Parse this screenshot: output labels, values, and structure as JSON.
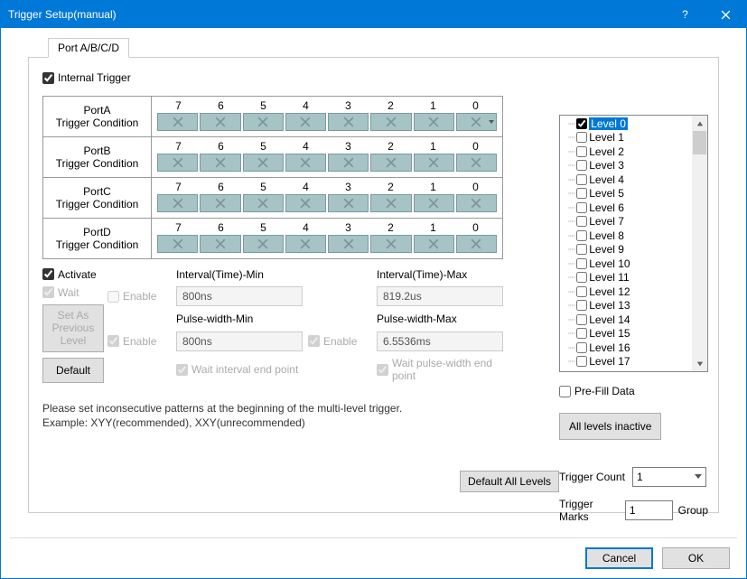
{
  "window": {
    "title": "Trigger Setup(manual)"
  },
  "tab": {
    "label": "Port A/B/C/D"
  },
  "internal_trigger": {
    "label": "Internal Trigger",
    "checked": true
  },
  "bits": [
    "7",
    "6",
    "5",
    "4",
    "3",
    "2",
    "1",
    "0"
  ],
  "ports": [
    {
      "name": "PortA",
      "cond": "Trigger Condition"
    },
    {
      "name": "PortB",
      "cond": "Trigger Condition"
    },
    {
      "name": "PortC",
      "cond": "Trigger Condition"
    },
    {
      "name": "PortD",
      "cond": "Trigger Condition"
    }
  ],
  "activate": {
    "label": "Activate",
    "checked": true
  },
  "wait": {
    "label": "Wait",
    "checked": true
  },
  "set_prev": "Set As Previous Level",
  "default_btn": "Default",
  "intv_min": {
    "head": "Interval(Time)-Min",
    "enable": "Enable",
    "value": "800ns"
  },
  "intv_max": {
    "head": "Interval(Time)-Max",
    "value": "819.2us"
  },
  "pw_min": {
    "head": "Pulse-width-Min",
    "enable": "Enable",
    "value": "800ns"
  },
  "pw_max": {
    "head": "Pulse-width-Max",
    "enable": "Enable",
    "value": "6.5536ms"
  },
  "wait_int": "Wait interval end point",
  "wait_pw": "Wait pulse-width end point",
  "note1": "Please set inconsecutive patterns at the beginning of the multi-level trigger.",
  "note2": "Example: XYY(recommended), XXY(unrecommended)",
  "default_all": "Default All Levels",
  "levels": [
    "Level 0",
    "Level 1",
    "Level 2",
    "Level 3",
    "Level 4",
    "Level 5",
    "Level 6",
    "Level 7",
    "Level 8",
    "Level 9",
    "Level 10",
    "Level 11",
    "Level 12",
    "Level 13",
    "Level 14",
    "Level 15",
    "Level 16",
    "Level 17"
  ],
  "level_selected": 0,
  "prefill": {
    "label": "Pre-Fill Data",
    "checked": false
  },
  "all_inactive": "All levels inactive",
  "tcount": {
    "label": "Trigger Count",
    "value": "1"
  },
  "tmarks": {
    "label": "Trigger Marks",
    "value": "1",
    "unit": "Group"
  },
  "footer": {
    "cancel": "Cancel",
    "ok": "OK"
  }
}
